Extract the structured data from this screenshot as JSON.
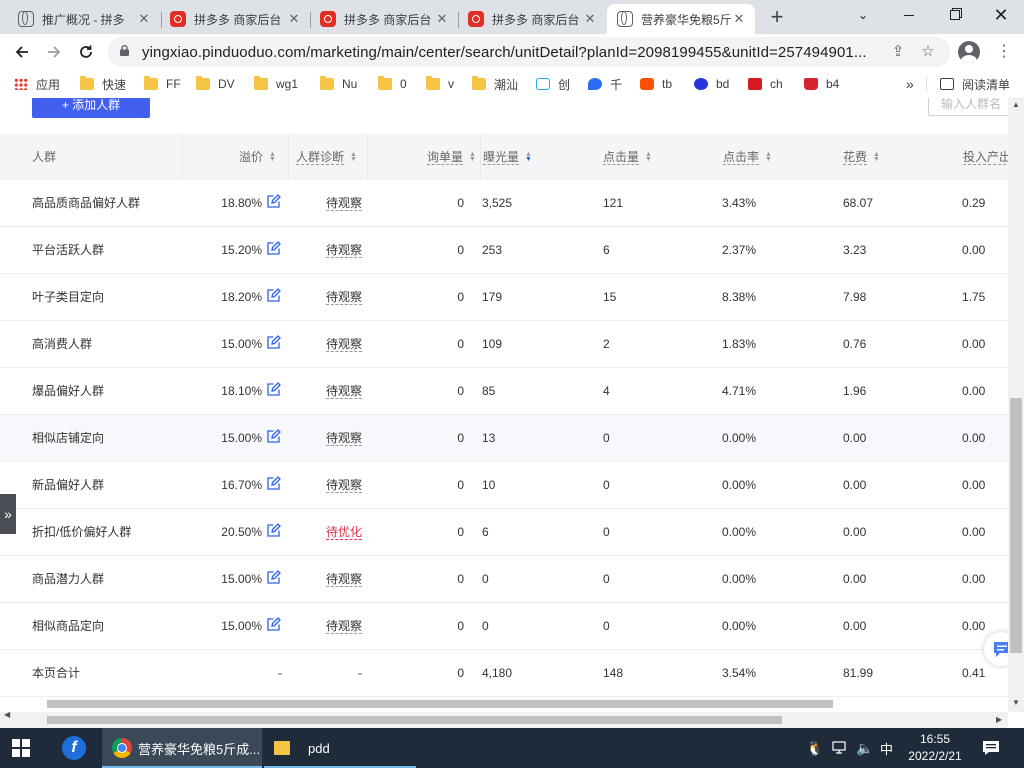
{
  "browser": {
    "tabs": [
      {
        "title": "推广概况 - 拼多",
        "icon": "globe-icon",
        "active": false
      },
      {
        "title": "拼多多 商家后台",
        "icon": "pdd-icon",
        "active": false
      },
      {
        "title": "拼多多 商家后台",
        "icon": "pdd-icon",
        "active": false
      },
      {
        "title": "拼多多 商家后台",
        "icon": "pdd-icon",
        "active": false
      },
      {
        "title": "营养豪华免粮5斤",
        "icon": "globe-icon",
        "active": true
      }
    ],
    "url": "yingxiao.pinduoduo.com/marketing/main/center/search/unitDetail?planId=2098199455&unitId=257494901..."
  },
  "bookmarks": [
    {
      "label": "应用",
      "icon": "apps-icon"
    },
    {
      "label": "快速",
      "icon": "folder-icon"
    },
    {
      "label": "FF",
      "icon": "folder-icon"
    },
    {
      "label": "DV",
      "icon": "folder-icon"
    },
    {
      "label": "wg1",
      "icon": "folder-icon"
    },
    {
      "label": "Nu",
      "icon": "folder-icon"
    },
    {
      "label": "0",
      "icon": "folder-icon"
    },
    {
      "label": "v",
      "icon": "folder-icon"
    },
    {
      "label": "潮汕",
      "icon": "folder-icon"
    },
    {
      "label": "创",
      "icon": "bilibili-icon"
    },
    {
      "label": "千",
      "icon": "qianniu-icon"
    },
    {
      "label": "tb",
      "icon": "taobao-icon"
    },
    {
      "label": "bd",
      "icon": "baidu-icon"
    },
    {
      "label": "ch",
      "icon": "ch-icon"
    },
    {
      "label": "b4",
      "icon": "bag-icon"
    }
  ],
  "bookmarks_more": "»",
  "reading_list": "阅读清单",
  "page": {
    "add_button": "+ 添加人群",
    "search_placeholder": "输入人群名",
    "headers": [
      "人群",
      "溢价",
      "人群诊断",
      "询单量",
      "曝光量",
      "点击量",
      "点击率",
      "花费",
      "投入产出"
    ],
    "rows": [
      {
        "name": "高品质商品偏好人群",
        "premium": "18.80%",
        "diagnosis": "待观察",
        "inquiries": "0",
        "impressions": "3,525",
        "clicks": "121",
        "ctr": "3.43%",
        "cost": "68.07",
        "roi": "0.29"
      },
      {
        "name": "平台活跃人群",
        "premium": "15.20%",
        "diagnosis": "待观察",
        "inquiries": "0",
        "impressions": "253",
        "clicks": "6",
        "ctr": "2.37%",
        "cost": "3.23",
        "roi": "0.00"
      },
      {
        "name": "叶子类目定向",
        "premium": "18.20%",
        "diagnosis": "待观察",
        "inquiries": "0",
        "impressions": "179",
        "clicks": "15",
        "ctr": "8.38%",
        "cost": "7.98",
        "roi": "1.75"
      },
      {
        "name": "高消费人群",
        "premium": "15.00%",
        "diagnosis": "待观察",
        "inquiries": "0",
        "impressions": "109",
        "clicks": "2",
        "ctr": "1.83%",
        "cost": "0.76",
        "roi": "0.00"
      },
      {
        "name": "爆品偏好人群",
        "premium": "18.10%",
        "diagnosis": "待观察",
        "inquiries": "0",
        "impressions": "85",
        "clicks": "4",
        "ctr": "4.71%",
        "cost": "1.96",
        "roi": "0.00"
      },
      {
        "name": "相似店铺定向",
        "premium": "15.00%",
        "diagnosis": "待观察",
        "inquiries": "0",
        "impressions": "13",
        "clicks": "0",
        "ctr": "0.00%",
        "cost": "0.00",
        "roi": "0.00"
      },
      {
        "name": "新品偏好人群",
        "premium": "16.70%",
        "diagnosis": "待观察",
        "inquiries": "0",
        "impressions": "10",
        "clicks": "0",
        "ctr": "0.00%",
        "cost": "0.00",
        "roi": "0.00"
      },
      {
        "name": "折扣/低价偏好人群",
        "premium": "20.50%",
        "diagnosis": "待优化",
        "inquiries": "0",
        "impressions": "6",
        "clicks": "0",
        "ctr": "0.00%",
        "cost": "0.00",
        "roi": "0.00"
      },
      {
        "name": "商品潜力人群",
        "premium": "15.00%",
        "diagnosis": "待观察",
        "inquiries": "0",
        "impressions": "0",
        "clicks": "0",
        "ctr": "0.00%",
        "cost": "0.00",
        "roi": "0.00"
      },
      {
        "name": "相似商品定向",
        "premium": "15.00%",
        "diagnosis": "待观察",
        "inquiries": "0",
        "impressions": "0",
        "clicks": "0",
        "ctr": "0.00%",
        "cost": "0.00",
        "roi": "0.00"
      }
    ],
    "total": {
      "name": "本页合计",
      "premium": "-",
      "diagnosis": "-",
      "inquiries": "0",
      "impressions": "4,180",
      "clicks": "148",
      "ctr": "3.54%",
      "cost": "81.99",
      "roi": "0.41"
    },
    "side_expand": "»"
  },
  "taskbar": {
    "chrome_window": "营养豪华免粮5斤成...",
    "folder_window": "pdd",
    "ime": "中",
    "time": "16:55",
    "date": "2022/2/21"
  },
  "colors": {
    "primary": "#4160f0",
    "warn": "#e0334b",
    "edit_icon": "#2e61e6"
  }
}
